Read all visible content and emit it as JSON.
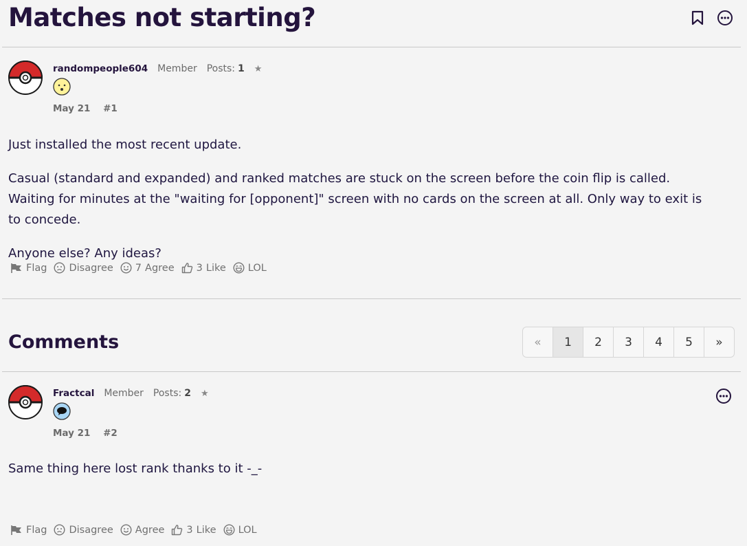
{
  "discussion": {
    "title": "Matches not starting?"
  },
  "original_post": {
    "username": "randompeople604",
    "role": "Member",
    "posts_label": "Posts:",
    "posts_count": "1",
    "date": "May 21",
    "number": "#1",
    "paragraphs": [
      "Just installed the most recent update.",
      "Casual (standard and expanded) and ranked matches are stuck on the screen before the coin flip is called. Waiting for minutes at the \"waiting for [opponent]\" screen with no cards on the screen at all. Only way to exit is to concede.",
      "Anyone else? Any ideas?"
    ],
    "reactions": {
      "flag": "Flag",
      "disagree": "Disagree",
      "agree_count": "7",
      "agree": "Agree",
      "like_count": "3",
      "like": "Like",
      "lol": "LOL"
    }
  },
  "comments": {
    "heading": "Comments",
    "pagination": {
      "prev": "«",
      "pages": [
        "1",
        "2",
        "3",
        "4",
        "5"
      ],
      "current": "1",
      "next": "»"
    }
  },
  "comment_1": {
    "username": "Fractcal",
    "role": "Member",
    "posts_label": "Posts:",
    "posts_count": "2",
    "date": "May 21",
    "number": "#2",
    "text": "Same thing here lost rank thanks to it -_-",
    "reactions": {
      "flag": "Flag",
      "disagree": "Disagree",
      "agree": "Agree",
      "like_count": "3",
      "like": "Like",
      "lol": "LOL"
    }
  },
  "colors": {
    "title": "#24143d",
    "text": "#1f1640",
    "muted": "#6b6b6b",
    "pokeball_red": "#d42a2a",
    "background": "#f4f4f4"
  }
}
